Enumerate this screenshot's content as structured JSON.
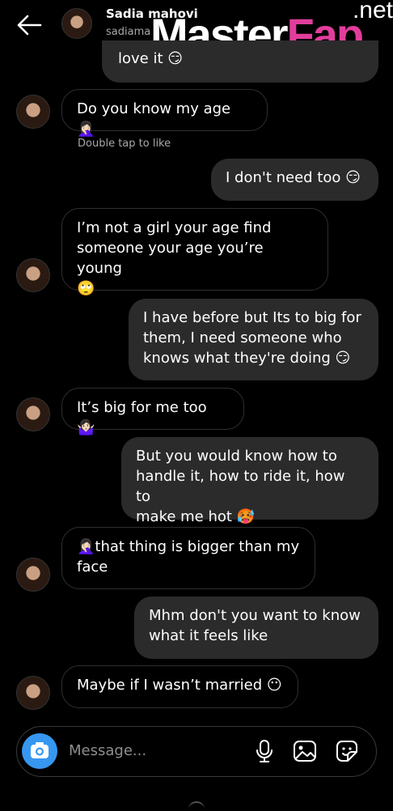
{
  "header": {
    "name": "Sadia mahovi",
    "username": "sadiama"
  },
  "watermark": {
    "main": "Master",
    "accent": "Fap",
    "tld": ".net"
  },
  "messages": [
    {
      "from": "me",
      "text": "love it 😏"
    },
    {
      "from": "them",
      "text": "Do you know my age 🤦🏻‍♀️"
    },
    {
      "from": "system",
      "text": "Double tap to like"
    },
    {
      "from": "me",
      "text": "I don't need too 😏"
    },
    {
      "from": "them",
      "text": "I’m not a girl your age find\nsomeone your age you’re young\n🙄"
    },
    {
      "from": "me",
      "text": "I have before but Its to big for\nthem, I need someone who\nknows what they're doing 😏"
    },
    {
      "from": "them",
      "text": "It’s big for me too 🤷🏻‍♀️"
    },
    {
      "from": "me",
      "text": "But you would know how to\nhandle it, how to ride it, how to\nmake me hot 🥵"
    },
    {
      "from": "them",
      "text": "🤦🏻‍♀️that thing is bigger than my\nface"
    },
    {
      "from": "me",
      "text": "Mhm don't you want to know\nwhat it feels like"
    },
    {
      "from": "them",
      "text": "Maybe if I wasn’t married 😶"
    }
  ],
  "composer": {
    "placeholder": "Message..."
  },
  "icons": {
    "back": "back-arrow-icon",
    "camera": "camera-icon",
    "mic": "microphone-icon",
    "gallery": "gallery-icon",
    "sticker": "sticker-icon"
  },
  "colors": {
    "background": "#000000",
    "outgoing_bubble": "#2b2b2b",
    "incoming_border": "#2f2f2f",
    "camera_button": "#3797f0",
    "secondary_text": "#a8a8a8",
    "watermark_accent": "#e23d9c"
  }
}
